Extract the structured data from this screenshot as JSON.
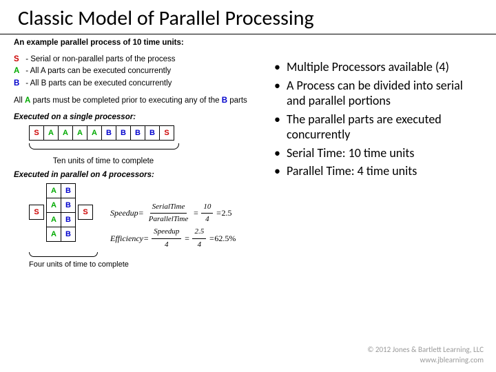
{
  "title": "Classic Model of Parallel Processing",
  "example_title": "An example parallel process of 10 time units:",
  "legend": {
    "s": {
      "key": "S",
      "text": "- Serial or non-parallel parts of the process"
    },
    "a": {
      "key": "A",
      "text": "- All A parts can be executed concurrently"
    },
    "b": {
      "key": "B",
      "text": "- All B parts can be executed concurrently"
    }
  },
  "completion_note_1": "All ",
  "completion_note_2": "A",
  "completion_note_3": " parts must be completed prior to  executing any of the ",
  "completion_note_4": "B",
  "completion_note_5": " parts",
  "section_single": "Executed on a single processor:",
  "single_cells": [
    "S",
    "A",
    "A",
    "A",
    "A",
    "B",
    "B",
    "B",
    "B",
    "S"
  ],
  "single_caption": "Ten units of time to complete",
  "section_parallel": "Executed in parallel on 4 processors:",
  "parallel_first": "S",
  "parallel_rows": [
    [
      "A",
      "B"
    ],
    [
      "A",
      "B"
    ],
    [
      "A",
      "B"
    ],
    [
      "A",
      "B"
    ]
  ],
  "parallel_last": "S",
  "parallel_caption": "Four units of time to complete",
  "equations": {
    "speedup_label": "Speedup",
    "serial_label": "SerialTime",
    "parallel_label": "ParallelTime",
    "serial_val": "10",
    "parallel_val": "4",
    "speedup_val": "2.5",
    "efficiency_label": "Efficiency",
    "eff_num_val": "2.5",
    "eff_den_val": "4",
    "efficiency_val": "62.5%",
    "eq": "="
  },
  "bullets": [
    "Multiple Processors available (4)",
    "A Process can be divided into serial and parallel portions",
    "The parallel parts are executed concurrently",
    "Serial Time:  10 time units",
    "Parallel Time: 4 time units"
  ],
  "copyright_line1": "© 2012 Jones & Bartlett Learning, LLC",
  "copyright_line2": "www.jblearning.com"
}
